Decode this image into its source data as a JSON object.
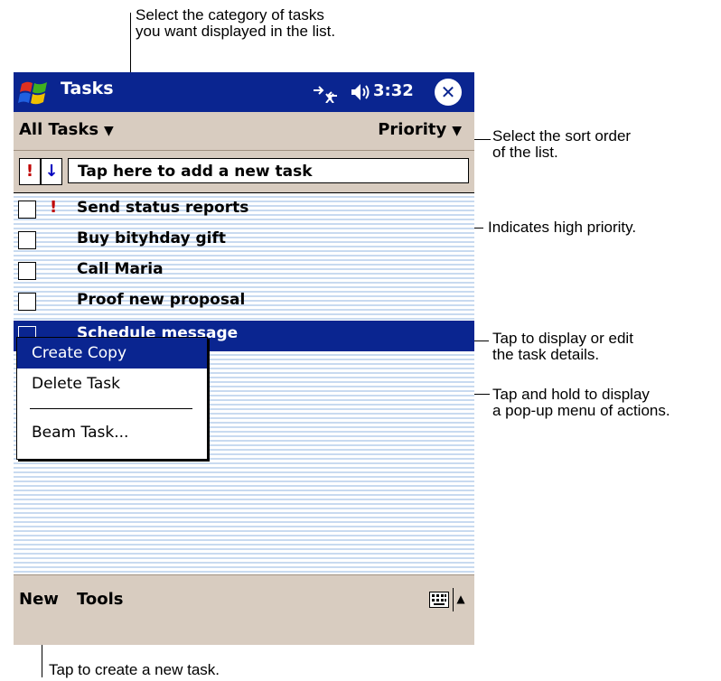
{
  "callouts": {
    "category": "Select the category of tasks\nyou want displayed in the list.",
    "sort": "Select the sort order\nof the list.",
    "priority": "Indicates high priority.",
    "details": "Tap to display or edit\nthe task details.",
    "popup": "Tap and hold to display\na pop-up menu of actions.",
    "new": "Tap to create a new task."
  },
  "titlebar": {
    "title": "Tasks",
    "clock": "3:32",
    "close": "✕"
  },
  "filterbar": {
    "category": "All Tasks",
    "sort": "Priority"
  },
  "entrybar": {
    "priority_glyph": "!",
    "sort_glyph": "↓",
    "placeholder": "Tap here to add a new task"
  },
  "tasks": [
    {
      "label": "Send status reports",
      "priority": "!"
    },
    {
      "label": "Buy bityhday gift",
      "priority": ""
    },
    {
      "label": "Call Maria",
      "priority": ""
    },
    {
      "label": "Proof new proposal",
      "priority": ""
    },
    {
      "label": "Schedule message",
      "priority": ""
    }
  ],
  "popup_menu": {
    "items": [
      "Create Copy",
      "Delete Task",
      "Beam Task..."
    ]
  },
  "menubar": {
    "new": "New",
    "tools": "Tools"
  },
  "colors": {
    "titlebar": "#0a2590",
    "chrome": "#d8ccc0",
    "stripe": "#c8daf0",
    "priority": "#c00000"
  },
  "icons": [
    "windows-start-icon",
    "connectivity-icon",
    "volume-icon",
    "close-icon",
    "keyboard-icon"
  ]
}
